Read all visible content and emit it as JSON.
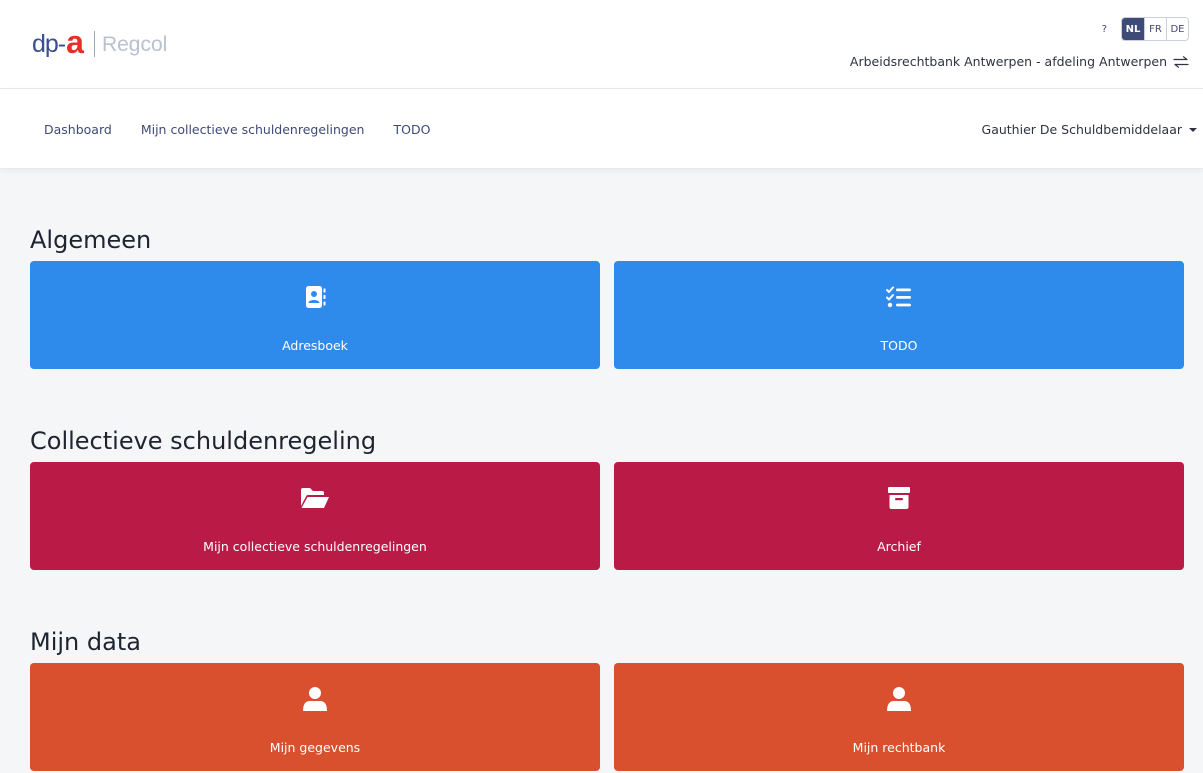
{
  "brand": {
    "logo_dp": "dp-",
    "logo_a": "a",
    "app_name": "Regcol"
  },
  "header": {
    "help_label": "?",
    "languages": [
      {
        "code": "NL",
        "active": true
      },
      {
        "code": "FR",
        "active": false
      },
      {
        "code": "DE",
        "active": false
      }
    ],
    "court_name": "Arbeidsrechtbank Antwerpen - afdeling Antwerpen"
  },
  "nav": {
    "links": [
      "Dashboard",
      "Mijn collectieve schuldenregelingen",
      "TODO"
    ],
    "user_name": "Gauthier De Schuldbemiddelaar"
  },
  "sections": [
    {
      "title": "Algemeen",
      "color": "#2f8beb",
      "tiles": [
        {
          "label": "Adresboek",
          "icon": "address-book-icon"
        },
        {
          "label": "TODO",
          "icon": "task-list-icon"
        }
      ]
    },
    {
      "title": "Collectieve schuldenregeling",
      "color": "#ba1a46",
      "tiles": [
        {
          "label": "Mijn collectieve schuldenregelingen",
          "icon": "folder-open-icon"
        },
        {
          "label": "Archief",
          "icon": "archive-box-icon"
        }
      ]
    },
    {
      "title": "Mijn data",
      "color": "#d8502e",
      "tiles": [
        {
          "label": "Mijn gegevens",
          "icon": "user-icon"
        },
        {
          "label": "Mijn rechtbank",
          "icon": "user-icon"
        }
      ]
    }
  ]
}
